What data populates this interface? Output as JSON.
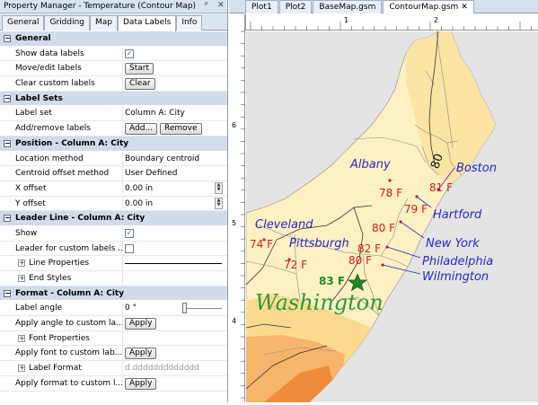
{
  "property_manager": {
    "title": "Property Manager - Temperature (Contour Map)",
    "pin_glyph": "ᵖ",
    "close_glyph": "✕",
    "tabs": [
      "General",
      "Gridding",
      "Map",
      "Data Labels",
      "Info"
    ],
    "sections": {
      "general": "General",
      "label_sets": "Label Sets",
      "position": "Position - Column A: City",
      "leader": "Leader Line - Column A: City",
      "format": "Format - Column A: City"
    },
    "rows": {
      "show_data_labels": "Show data labels",
      "move_edit": "Move/edit labels",
      "start_btn": "Start",
      "clear_custom": "Clear custom labels",
      "clear_btn": "Clear",
      "label_set": "Label set",
      "label_set_val": "Column A: City",
      "add_remove": "Add/remove labels",
      "add_btn": "Add...",
      "remove_btn": "Remove",
      "location_method": "Location method",
      "location_method_val": "Boundary centroid",
      "centroid_method": "Centroid offset method",
      "centroid_method_val": "User Defined",
      "x_offset": "X offset",
      "x_offset_val": "0.00 in",
      "y_offset": "Y offset",
      "y_offset_val": "0.00 in",
      "show": "Show",
      "leader_custom": "Leader for custom labels ...",
      "line_props": "Line Properties",
      "end_styles": "End Styles",
      "label_angle": "Label angle",
      "label_angle_val": "0 °",
      "apply_angle": "Apply angle to custom la...",
      "apply_btn": "Apply",
      "font_props": "Font Properties",
      "apply_font": "Apply font to custom lab...",
      "label_format": "Label Format",
      "label_format_val": "d.ddddddddddddd",
      "apply_format": "Apply format to custom l..."
    }
  },
  "doc_tabs": [
    "Plot1",
    "Plot2",
    "BaseMap.gsm",
    "ContourMap.gsm"
  ],
  "doc_close_glyph": "✕",
  "nav_glyph": "◁",
  "ruler": {
    "h_labels": [
      "1",
      "2"
    ],
    "v_labels": [
      "6",
      "5",
      "4"
    ]
  },
  "map": {
    "cities": [
      "Albany",
      "Boston",
      "Hartford",
      "New York",
      "Philadelphia",
      "Wilmington",
      "Cleveland",
      "Pittsburgh",
      "Washington"
    ],
    "temps": [
      "78 F",
      "81 F",
      "79 F",
      "80 F",
      "82 F",
      "80 F",
      "74 F",
      "72 F",
      "83 F"
    ],
    "contour_label": "80",
    "colors": {
      "land_light": "#fdf0c2",
      "land_mid": "#fbd991",
      "land_orange": "#f5b56a",
      "land_deep": "#ee8a3a",
      "sea": "#e4e4e4",
      "city_blue": "#2727c9",
      "temp_red": "#d81c1c",
      "capital_green": "#1f8a2a"
    }
  }
}
